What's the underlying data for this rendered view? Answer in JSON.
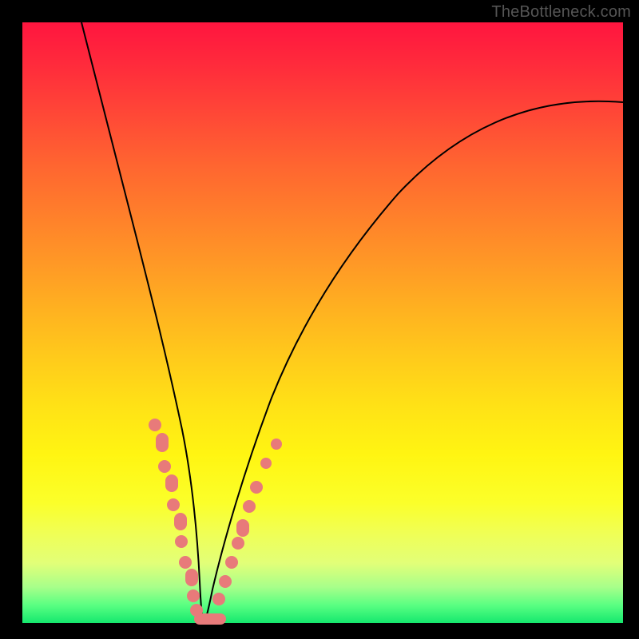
{
  "watermark": "TheBottleneck.com",
  "colors": {
    "frame": "#000000",
    "curve": "#000000",
    "dot": "#e87a7a",
    "gradient_top": "#ff153f",
    "gradient_bottom": "#15e86e"
  },
  "chart_data": {
    "type": "line",
    "title": "",
    "xlabel": "",
    "ylabel": "",
    "xlim": [
      0,
      100
    ],
    "ylim": [
      0,
      100
    ],
    "note": "Axes are unlabeled in the image; values below are estimated from pixel positions. y is percent height from bottom (0 = bottom/green, 100 = top/red). x is percent width from left.",
    "series": [
      {
        "name": "curve",
        "x": [
          10,
          12,
          14,
          16,
          18,
          20,
          22,
          24,
          26,
          28,
          29.5,
          31,
          33,
          36,
          40,
          46,
          54,
          64,
          76,
          90,
          100
        ],
        "y": [
          100,
          88,
          76,
          64,
          53,
          43,
          33,
          24,
          15,
          6,
          0,
          1,
          5,
          12,
          22,
          35,
          49,
          62,
          73,
          82,
          87
        ]
      }
    ],
    "markers": {
      "name": "highlighted-points",
      "note": "Salmon dots/segments clustered near curve minimum on both branches.",
      "points": [
        {
          "x": 22.0,
          "y": 33.0
        },
        {
          "x": 22.8,
          "y": 30.0
        },
        {
          "x": 23.7,
          "y": 26.0
        },
        {
          "x": 24.5,
          "y": 22.5
        },
        {
          "x": 25.2,
          "y": 19.0
        },
        {
          "x": 25.8,
          "y": 16.0
        },
        {
          "x": 26.5,
          "y": 13.0
        },
        {
          "x": 27.1,
          "y": 10.0
        },
        {
          "x": 27.7,
          "y": 7.5
        },
        {
          "x": 28.3,
          "y": 5.0
        },
        {
          "x": 28.9,
          "y": 2.5
        },
        {
          "x": 29.5,
          "y": 0.5
        },
        {
          "x": 30.2,
          "y": 0.5
        },
        {
          "x": 31.0,
          "y": 0.8
        },
        {
          "x": 32.5,
          "y": 4.0
        },
        {
          "x": 33.5,
          "y": 7.0
        },
        {
          "x": 34.5,
          "y": 10.0
        },
        {
          "x": 35.5,
          "y": 12.5
        },
        {
          "x": 36.5,
          "y": 15.0
        },
        {
          "x": 37.5,
          "y": 17.5
        },
        {
          "x": 38.5,
          "y": 20.0
        },
        {
          "x": 40.5,
          "y": 25.0
        },
        {
          "x": 42.0,
          "y": 28.0
        }
      ]
    }
  }
}
